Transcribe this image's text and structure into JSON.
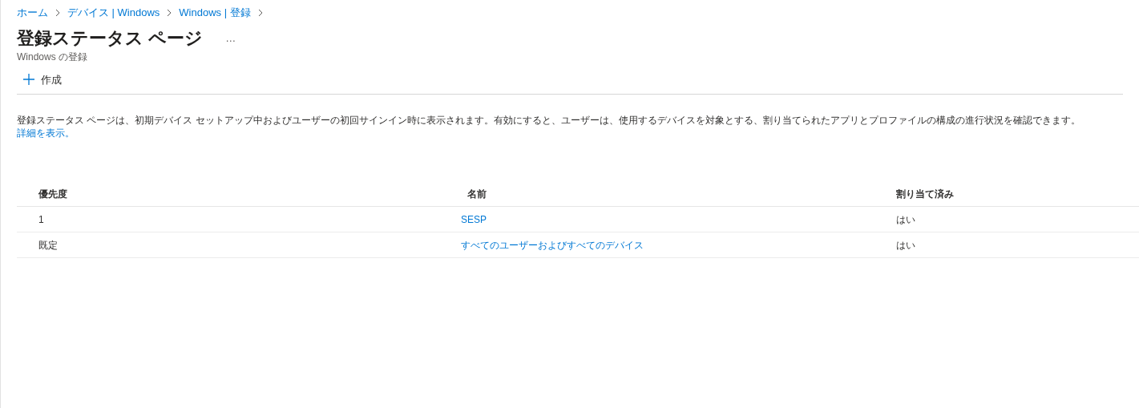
{
  "breadcrumb": [
    "ホーム",
    "デバイス | Windows",
    "Windows | 登録"
  ],
  "page": {
    "title": "登録ステータス ページ",
    "more": "…",
    "subtitle": "Windows の登録"
  },
  "toolbar": {
    "create": "作成"
  },
  "description": {
    "text": "登録ステータス ページは、初期デバイス セットアップ中およびユーザーの初回サインイン時に表示されます。有効にすると、ユーザーは、使用するデバイスを対象とする、割り当てられたアプリとプロファイルの構成の進行状況を確認できます。",
    "link": "詳細を表示。"
  },
  "table": {
    "columns": [
      "優先度",
      "名前",
      "割り当て済み"
    ],
    "rows": [
      {
        "priority": "1",
        "name": "SESP",
        "assigned": "はい"
      },
      {
        "priority": "既定",
        "name": "すべてのユーザーおよびすべてのデバイス",
        "assigned": "はい"
      }
    ]
  }
}
